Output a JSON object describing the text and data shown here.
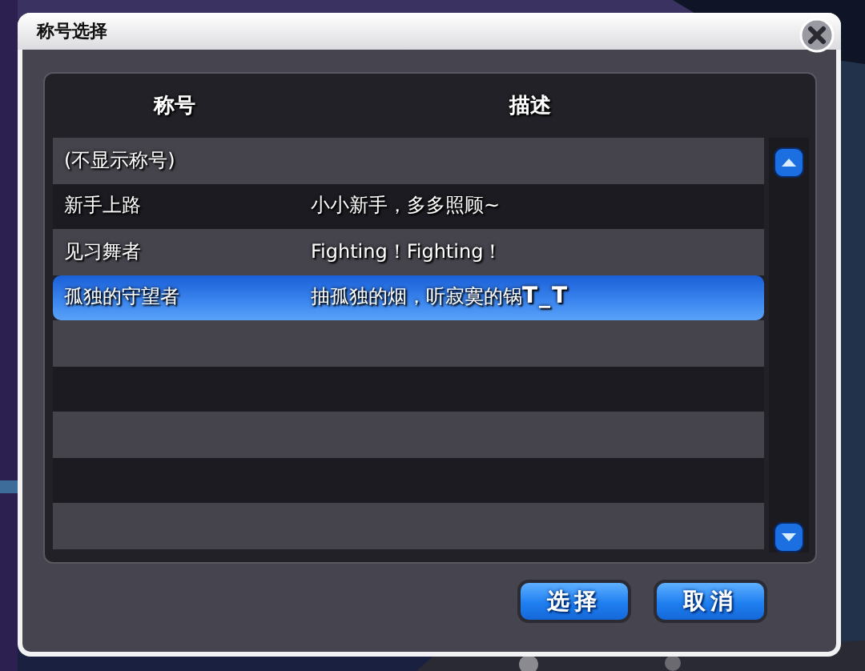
{
  "window": {
    "title": "称号选择"
  },
  "table": {
    "columns": [
      "称号",
      "描述"
    ],
    "rows": [
      {
        "title": "(不显示称号)",
        "description": "",
        "selected": false
      },
      {
        "title": "新手上路",
        "description": "小小新手，多多照顾~",
        "selected": false
      },
      {
        "title": "见习舞者",
        "description": "Fighting！Fighting！",
        "selected": false
      },
      {
        "title": "孤独的守望者",
        "description": "抽孤独的烟，听寂寞的锅**T_T**",
        "selected": true
      }
    ]
  },
  "buttons": [
    "选择",
    "取消"
  ]
}
